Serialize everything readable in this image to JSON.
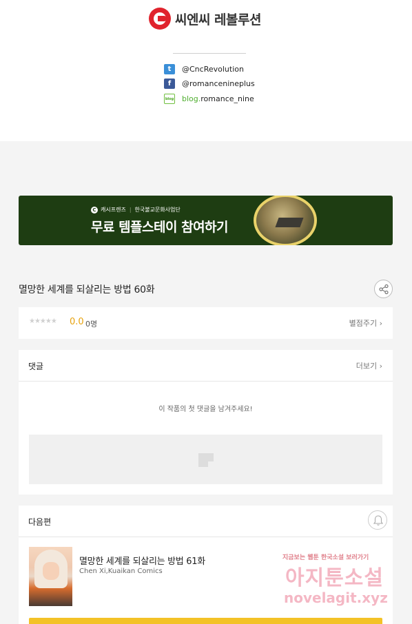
{
  "header": {
    "brand_name": "씨엔씨 레볼루션",
    "social": [
      {
        "icon": "twitter-icon",
        "prefix": "",
        "text": "@CncRevolution"
      },
      {
        "icon": "facebook-icon",
        "prefix": "",
        "text": "@romancenineplus"
      },
      {
        "icon": "blog-icon",
        "prefix": "blog.",
        "text": "romance_nine"
      }
    ]
  },
  "banner": {
    "sponsor": "캐시프렌즈",
    "partner": "한국불교문화사업단",
    "title": "무료 템플스테이 참여하기"
  },
  "episode": {
    "title": "멸망한 세계를 되살리는 방법 60화"
  },
  "rating": {
    "stars": "★★★★★",
    "score": "0.0",
    "count": "0명",
    "rate_link": "별점주기"
  },
  "comments": {
    "title": "댓글",
    "more": "더보기",
    "empty_message": "이 작품의 첫 댓글을 남겨주세요!"
  },
  "next": {
    "title": "다음편",
    "episode_title": "멸망한 세계를 되살리는 방법 61화",
    "authors": "Chen Xi,Kuaikan Comics"
  },
  "watermark": {
    "tagline": "지금보는 웹툰 한국소설 보러가기",
    "site": "아지툰소설",
    "url": "novelagit.xyz"
  },
  "colors": {
    "brand_red": "#e0232d",
    "banner_bg": "#1e3d12",
    "score": "#e7a20d",
    "cta_yellow": "#f3c227"
  }
}
